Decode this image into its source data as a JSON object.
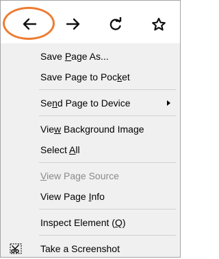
{
  "nav": {
    "back_icon": "arrow-left-icon",
    "forward_icon": "arrow-right-icon",
    "reload_icon": "reload-icon",
    "bookmark_icon": "star-icon",
    "highlight_color": "#ee7b30"
  },
  "menu": {
    "save_page_as": {
      "pre": "Save ",
      "key": "P",
      "post": "age As..."
    },
    "save_to_pocket": {
      "pre": "Save Page to Poc",
      "key": "k",
      "post": "et"
    },
    "send_to_device": {
      "pre": "Se",
      "key": "n",
      "post": "d Page to Device"
    },
    "view_bg_image": {
      "pre": "Vie",
      "key": "w",
      "post": " Background Image"
    },
    "select_all": {
      "pre": "Select ",
      "key": "A",
      "post": "ll"
    },
    "view_source": {
      "pre": "",
      "key": "V",
      "post": "iew Page Source"
    },
    "view_info": {
      "pre": "View Page ",
      "key": "I",
      "post": "nfo"
    },
    "inspect": {
      "pre": "Inspect Element (",
      "key": "Q",
      "post": ")"
    },
    "screenshot": {
      "pre": "Take a Screenshot",
      "key": "",
      "post": ""
    },
    "screenshot_icon": "screenshot-scissors-icon"
  }
}
